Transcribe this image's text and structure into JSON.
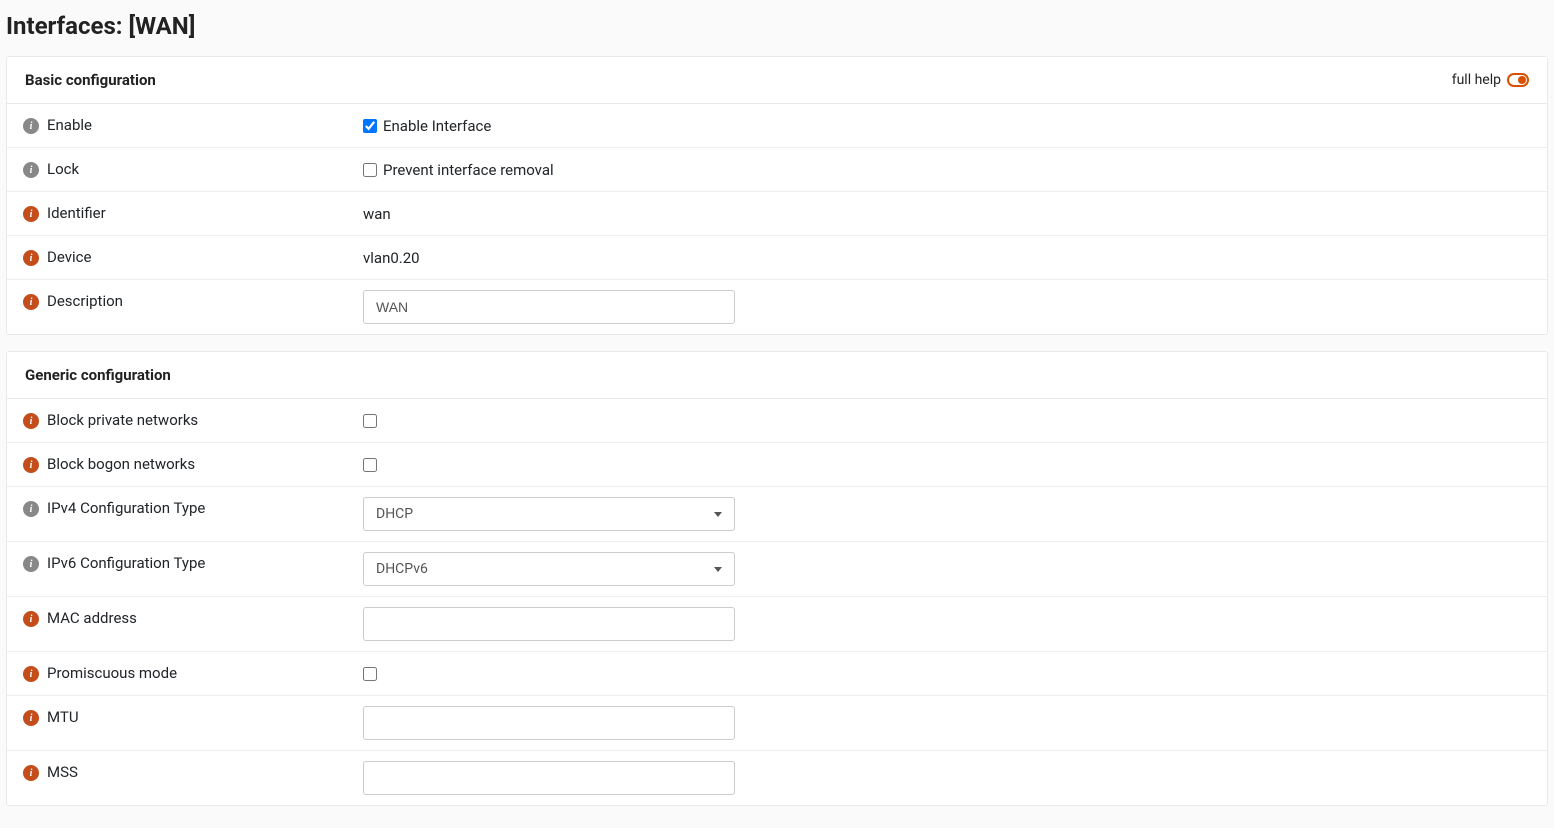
{
  "page_title": "Interfaces: [WAN]",
  "full_help_label": "full help",
  "sections": {
    "basic": {
      "title": "Basic configuration",
      "enable": {
        "label": "Enable",
        "checkbox_label": "Enable Interface",
        "checked": true
      },
      "lock": {
        "label": "Lock",
        "checkbox_label": "Prevent interface removal",
        "checked": false
      },
      "identifier": {
        "label": "Identifier",
        "value": "wan"
      },
      "device": {
        "label": "Device",
        "value": "vlan0.20"
      },
      "description": {
        "label": "Description",
        "value": "WAN"
      }
    },
    "generic": {
      "title": "Generic configuration",
      "block_private": {
        "label": "Block private networks",
        "checked": false
      },
      "block_bogon": {
        "label": "Block bogon networks",
        "checked": false
      },
      "ipv4_type": {
        "label": "IPv4 Configuration Type",
        "value": "DHCP"
      },
      "ipv6_type": {
        "label": "IPv6 Configuration Type",
        "value": "DHCPv6"
      },
      "mac": {
        "label": "MAC address",
        "value": ""
      },
      "promiscuous": {
        "label": "Promiscuous mode",
        "checked": false
      },
      "mtu": {
        "label": "MTU",
        "value": ""
      },
      "mss": {
        "label": "MSS",
        "value": ""
      }
    }
  }
}
